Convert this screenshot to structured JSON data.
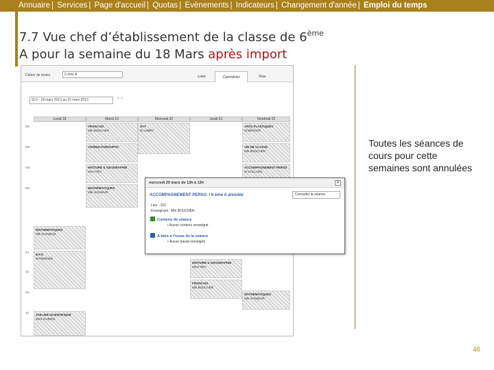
{
  "topnav": {
    "items": [
      "Annuaire",
      "Services",
      "Page d'accueil",
      "Quotas",
      "Evènements",
      "Indicateurs",
      "Changement d'année"
    ],
    "current": "Emploi du temps"
  },
  "title": {
    "line1_prefix": "7.7 Vue chef d’établissement de la classe de 6",
    "line1_sup": "ème",
    "line2_prefix": "A pour la semaine du 18 Mars ",
    "line2_accent": "après import"
  },
  "colors": {
    "nav_bg": "#a8801c",
    "accent_text": "#9b1b1b",
    "page_number": "#b39012",
    "link_blue": "#2f5fa8"
  },
  "screenshot": {
    "cahier_label": "Cahier de textes",
    "cahier_value": "6 ème A",
    "tabs": {
      "list": "Liste",
      "calendar": "Calendrier",
      "visa": "Visa"
    },
    "week_select": "S12 - 18 mars 2013 au 22 mars 2013",
    "nav_icons": [
      "chevron-left-icon",
      "chevron-right-icon"
    ],
    "days": [
      "Lundi 18",
      "Mardi 19",
      "Mercredi 20",
      "Jeudi 21",
      "Vendredi 22"
    ],
    "hours": [
      "M1",
      "M2",
      "M3",
      "M4",
      "S1",
      "S2",
      "S3",
      "S4"
    ],
    "cells": [
      {
        "title": "FRANCAIS",
        "teacher": "Mle BOUCHER"
      },
      {
        "title": "SVT",
        "teacher": "M AUBRY"
      },
      {
        "title": "ARTS PLASTIQUES",
        "teacher": "M BERGER"
      },
      {
        "title": "CDI/MULTIGROUPOC",
        "teacher": ""
      },
      {
        "title": "VIE DE CLASSE",
        "teacher": "Mle BOUCHER"
      },
      {
        "title": "HISTOIRE & GEOGRAPHIE",
        "teacher": "Mme REY"
      },
      {
        "title": "ACCOMPAGNEMENT PERSO",
        "teacher": "M VAILLARD"
      },
      {
        "title": "MATHEMATIQUES",
        "teacher": "Mle VASSEUR"
      },
      {
        "title": "MATHEMATIQUES",
        "teacher": "Mle VASSEUR"
      },
      {
        "title": "E.P.S",
        "teacher": "M PERRIER"
      },
      {
        "title": "HISTOIRE & GEOGRAPHIE",
        "teacher": "Mme REY"
      },
      {
        "title": "FRANCAIS",
        "teacher": "Mle BOUCHER"
      },
      {
        "title": "MATHEMATIQUES",
        "teacher": "Mle VASSEUR"
      },
      {
        "title": "ATELIER SCIENTIFIQUE",
        "teacher": "Mme DUBOIS"
      }
    ]
  },
  "popup": {
    "header": "mercredi 20 mars de 13h à 13h",
    "subject": "ACCOMPAGNEMENT PERSO. / 6 ème A annulée",
    "button": "Consulter la séance",
    "room": "Lieu : 101",
    "teacher": "Enseignant : Mle BOUCHER",
    "content_title": "Contenu de séance",
    "content_value": "Aucun contenu renseigné",
    "todo_title": "A faire à l'issue de la séance",
    "todo_value": "Aucun travail renseigné",
    "close_label": "✕"
  },
  "note": "Toutes les séances de cours pour cette semaines sont annulées",
  "page_number": "46"
}
